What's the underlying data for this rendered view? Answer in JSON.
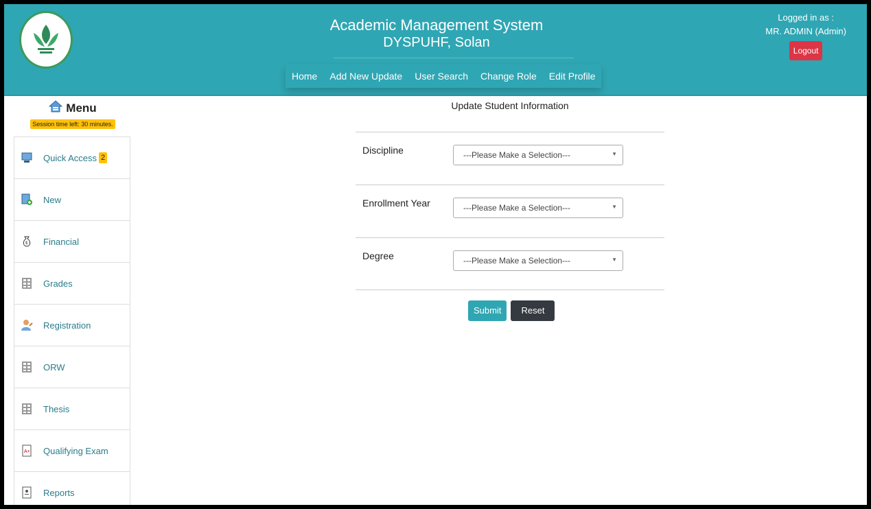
{
  "header": {
    "title": "Academic Management System",
    "subtitle": "DYSPUHF, Solan",
    "nav": [
      "Home",
      "Add New Update",
      "User Search",
      "Change Role",
      "Edit Profile"
    ],
    "logged_in_label": "Logged in as :",
    "user": "MR. ADMIN (Admin)",
    "logout_label": "Logout"
  },
  "sidebar": {
    "menu_label": "Menu",
    "session_text": "Session time left: 30 minutes.",
    "items": [
      {
        "label": "Quick Access",
        "badge": "2",
        "icon": "monitor-icon"
      },
      {
        "label": "New",
        "icon": "new-doc-icon"
      },
      {
        "label": "Financial",
        "icon": "money-bag-icon"
      },
      {
        "label": "Grades",
        "icon": "grid-icon"
      },
      {
        "label": "Registration",
        "icon": "user-icon"
      },
      {
        "label": "ORW",
        "icon": "grid-icon"
      },
      {
        "label": "Thesis",
        "icon": "grid-icon"
      },
      {
        "label": "Qualifying Exam",
        "icon": "exam-icon"
      },
      {
        "label": "Reports",
        "icon": "report-icon"
      }
    ]
  },
  "main": {
    "heading": "Update Student Information",
    "fields": [
      {
        "label": "Discipline",
        "value": "---Please Make a Selection---"
      },
      {
        "label": "Enrollment Year",
        "value": "---Please Make a Selection---"
      },
      {
        "label": "Degree",
        "value": "---Please Make a Selection---"
      }
    ],
    "submit_label": "Submit",
    "reset_label": "Reset"
  },
  "colors": {
    "header_bg": "#2fa6b3",
    "logout_bg": "#dc3545",
    "badge_bg": "#ffc107",
    "reset_bg": "#343a40"
  }
}
